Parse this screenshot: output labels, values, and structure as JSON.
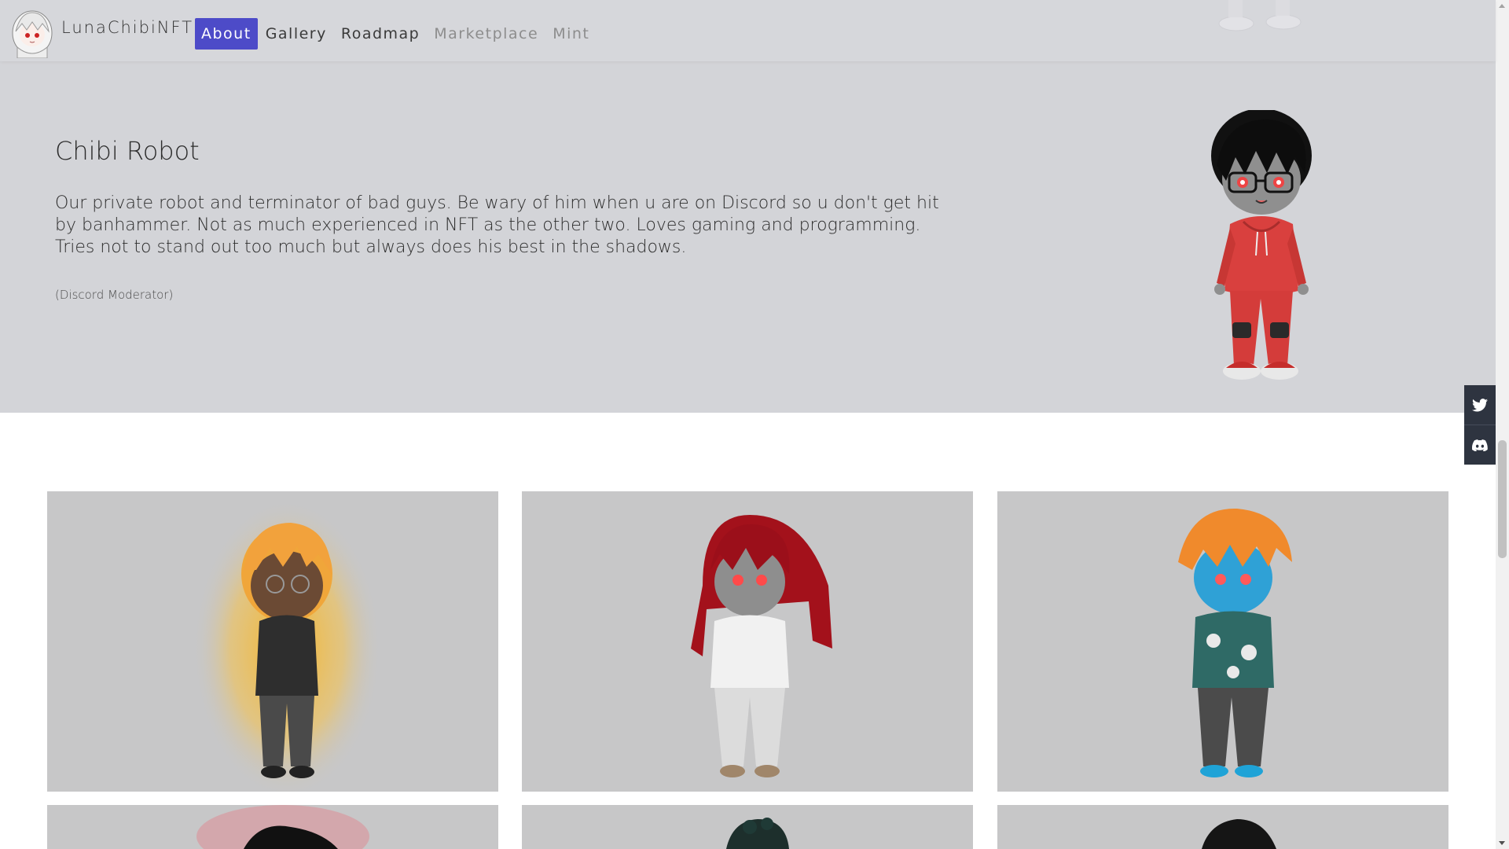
{
  "brand": {
    "name": "LunaChibiNFT",
    "logo_icon": "chibi-avatar-logo"
  },
  "nav": {
    "items": [
      {
        "label": "About",
        "state": "active"
      },
      {
        "label": "Gallery",
        "state": "normal"
      },
      {
        "label": "Roadmap",
        "state": "normal"
      },
      {
        "label": "Marketplace",
        "state": "muted"
      },
      {
        "label": "Mint",
        "state": "muted"
      }
    ]
  },
  "team_member": {
    "name": "Chibi Robot",
    "description": "Our private robot and terminator of bad guys. Be wary of him when u are on Discord so u don't get hit by banhammer. Not as much experienced in NFT as the other two. Loves gaming and programming. Tries not to stand out too much but always does his best in the shadows.",
    "role": "(Discord Moderator)"
  },
  "social": {
    "items": [
      {
        "icon": "twitter-icon"
      },
      {
        "icon": "discord-icon"
      }
    ]
  },
  "gallery": {
    "items": [
      {
        "character": "chibi-glasses-golden-aura"
      },
      {
        "character": "chibi-red-hair-white-hoodie"
      },
      {
        "character": "chibi-blue-skin-orange-hair"
      },
      {
        "character": "chibi-black-hair-red-aura"
      },
      {
        "character": "chibi-dark-green-hair"
      },
      {
        "character": "chibi-black-spiky-hair"
      }
    ]
  },
  "colors": {
    "accent": "#4d4bc8",
    "section_bg": "#d3d4d8",
    "card_bg": "#c7c7c8",
    "social_bg": "#2e3440"
  }
}
